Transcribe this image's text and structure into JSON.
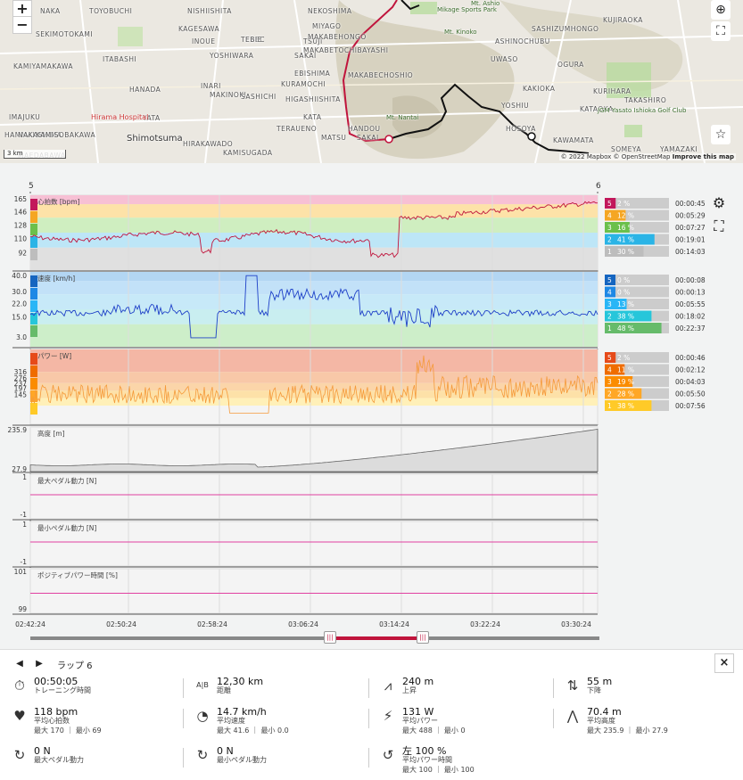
{
  "map": {
    "zoom_in": "+",
    "zoom_out": "−",
    "scale": "3 km",
    "attribution_1": "© 2022 Mapbox © OpenStreetMap",
    "attribution_2": "Improve this map",
    "labels": [
      {
        "t": "NAKA",
        "c": ""
      },
      {
        "t": "TOYOBUCHI",
        "c": ""
      },
      {
        "t": "NISHIISHITA",
        "c": ""
      },
      {
        "t": "NEKOSHIMA",
        "c": ""
      },
      {
        "t": "SEKIMOTOKAMI",
        "c": ""
      },
      {
        "t": "KAGESAWA",
        "c": ""
      },
      {
        "t": "MIYAGO",
        "c": ""
      },
      {
        "t": "TEBEC",
        "c": ""
      },
      {
        "t": "INOUE",
        "c": ""
      },
      {
        "t": "EBIE",
        "c": ""
      },
      {
        "t": "TSUJI",
        "c": ""
      },
      {
        "t": "MAKABEHONGO",
        "c": ""
      },
      {
        "t": "MAKABETOCHIBAYASHI",
        "c": ""
      },
      {
        "t": "KAMIYAMAKAWA",
        "c": ""
      },
      {
        "t": "ITABASHI",
        "c": ""
      },
      {
        "t": "YOSHIWARA",
        "c": ""
      },
      {
        "t": "SAKAI",
        "c": ""
      },
      {
        "t": "HANADA",
        "c": ""
      },
      {
        "t": "INARI",
        "c": ""
      },
      {
        "t": "KURAMOCHI",
        "c": ""
      },
      {
        "t": "EBISHIMA",
        "c": ""
      },
      {
        "t": "MAKABECHOSHIO",
        "c": ""
      },
      {
        "t": "MAKINOKI",
        "c": ""
      },
      {
        "t": "SASHICHI",
        "c": ""
      },
      {
        "t": "IMAJUKU",
        "c": ""
      },
      {
        "t": "YATA",
        "c": ""
      },
      {
        "t": "HIGASHIISHITA",
        "c": ""
      },
      {
        "t": "KATA",
        "c": ""
      },
      {
        "t": "TERAUENO",
        "c": ""
      },
      {
        "t": "HANDOU",
        "c": ""
      },
      {
        "t": "MATSU",
        "c": ""
      },
      {
        "t": "SAKAI",
        "c": ""
      },
      {
        "t": "Shimotsuma",
        "c": "big"
      },
      {
        "t": "HIRAKAWADO",
        "c": ""
      },
      {
        "t": "MAEDABAWA",
        "c": ""
      },
      {
        "t": "KAMISUGADA",
        "c": ""
      },
      {
        "t": "HAMMAKAMI",
        "c": ""
      },
      {
        "t": "NAKASHIMA",
        "c": ""
      },
      {
        "t": "KAMISOBAKAWA",
        "c": ""
      },
      {
        "t": "Hirama Hospital",
        "c": "hosp"
      },
      {
        "t": "Mikage Sports Park",
        "c": "green"
      },
      {
        "t": "Mt. Kinoko",
        "c": "green"
      },
      {
        "t": "Mt. Nantai",
        "c": "green"
      },
      {
        "t": "Mt. Ashio",
        "c": "green"
      },
      {
        "t": "HONGO",
        "c": ""
      },
      {
        "t": "KUJIRAOKA",
        "c": ""
      },
      {
        "t": "SASHIZUMI",
        "c": ""
      },
      {
        "t": "ASHINOCHUBU",
        "c": ""
      },
      {
        "t": "UWASO",
        "c": ""
      },
      {
        "t": "OGURA",
        "c": ""
      },
      {
        "t": "KAKIOKA",
        "c": ""
      },
      {
        "t": "YOSHIU",
        "c": ""
      },
      {
        "t": "KATAOKA",
        "c": ""
      },
      {
        "t": "HOSOYA",
        "c": ""
      },
      {
        "t": "KAWAMATA",
        "c": ""
      },
      {
        "t": "SOMEYA",
        "c": ""
      },
      {
        "t": "JGM Yasato Ishioka Golf Club",
        "c": "green"
      },
      {
        "t": "TAKASHIRO",
        "c": ""
      },
      {
        "t": "YAMAZAKI",
        "c": ""
      },
      {
        "t": "KURIHARA",
        "c": ""
      }
    ]
  },
  "charts": {
    "lap_start": "5",
    "lap_end": "6",
    "x_ticks": [
      "02:42:24",
      "02:50:24",
      "02:58:24",
      "03:06:24",
      "03:14:24",
      "03:22:24",
      "03:30:24"
    ],
    "panels": [
      {
        "title": "心拍数 [bpm]",
        "ticks": [
          "165",
          "146",
          "128",
          "110",
          "92"
        ]
      },
      {
        "title": "速度 [km/h]",
        "ticks": [
          "40.0",
          "30.0",
          "22.0",
          "15.0",
          "3.0"
        ]
      },
      {
        "title": "パワー [W]",
        "ticks": [
          "316",
          "276",
          "237",
          "197",
          "145"
        ]
      },
      {
        "title": "高度 [m]",
        "ticks": [
          "235.9",
          "27.9"
        ]
      },
      {
        "title": "最大ペダル動力 [N]",
        "ticks": [
          "1",
          "-1"
        ]
      },
      {
        "title": "最小ペダル動力 [N]",
        "ticks": [
          "1",
          "-1"
        ]
      },
      {
        "title": "ポジティブパワー時間 [%]",
        "ticks": [
          "101",
          "99"
        ]
      }
    ],
    "zones": [
      [
        {
          "z": "5",
          "pct": "2 %",
          "time": "00:00:45",
          "color": "#c2185b"
        },
        {
          "z": "4",
          "pct": "12 %",
          "time": "00:05:29",
          "color": "#f5a623"
        },
        {
          "z": "3",
          "pct": "16 %",
          "time": "00:07:27",
          "color": "#6bc04b"
        },
        {
          "z": "2",
          "pct": "41 %",
          "time": "00:19:01",
          "color": "#2ab4e6"
        },
        {
          "z": "1",
          "pct": "30 %",
          "time": "00:14:03",
          "color": "#bdbdbd"
        }
      ],
      [
        {
          "z": "5",
          "pct": "0 %",
          "time": "00:00:08",
          "color": "#1565c0"
        },
        {
          "z": "4",
          "pct": "0 %",
          "time": "00:00:13",
          "color": "#1e88e5"
        },
        {
          "z": "3",
          "pct": "13 %",
          "time": "00:05:55",
          "color": "#29b6f6"
        },
        {
          "z": "2",
          "pct": "38 %",
          "time": "00:18:02",
          "color": "#26c6da"
        },
        {
          "z": "1",
          "pct": "48 %",
          "time": "00:22:37",
          "color": "#66bb6a"
        }
      ],
      [
        {
          "z": "5",
          "pct": "2 %",
          "time": "00:00:46",
          "color": "#e64a19"
        },
        {
          "z": "4",
          "pct": "11 %",
          "time": "00:02:12",
          "color": "#ef6c00"
        },
        {
          "z": "3",
          "pct": "19 %",
          "time": "00:04:03",
          "color": "#fb8c00"
        },
        {
          "z": "2",
          "pct": "28 %",
          "time": "00:05:50",
          "color": "#ffa726"
        },
        {
          "z": "1",
          "pct": "38 %",
          "time": "00:07:56",
          "color": "#ffca28"
        }
      ]
    ]
  },
  "summary": {
    "lap_label": "ラップ 6",
    "close": "×",
    "stats": [
      {
        "icon": "stopwatch-icon",
        "glyph": "⏱",
        "val": "00:50:05",
        "lbl": "トレーニング時間",
        "sub": ""
      },
      {
        "icon": "distance-icon",
        "glyph": "A|B",
        "val": "12,30 km",
        "lbl": "距離",
        "sub": ""
      },
      {
        "icon": "ascent-icon",
        "glyph": "⩘",
        "val": "240 m",
        "lbl": "上昇",
        "sub": ""
      },
      {
        "icon": "descent-icon",
        "glyph": "⇅",
        "val": "55 m",
        "lbl": "下降",
        "sub": ""
      },
      {
        "icon": "heart-icon",
        "glyph": "♥",
        "val": "118 bpm",
        "lbl": "平均心拍数",
        "sub": "最大 170 ｜ 最小 69"
      },
      {
        "icon": "speedometer-icon",
        "glyph": "◔",
        "val": "14.7 km/h",
        "lbl": "平均速度",
        "sub": "最大 41.6 ｜ 最小 0.0"
      },
      {
        "icon": "power-icon",
        "glyph": "⚡",
        "val": "131 W",
        "lbl": "平均パワー",
        "sub": "最大 488 ｜ 最小 0"
      },
      {
        "icon": "altitude-icon",
        "glyph": "⋀",
        "val": "70.4 m",
        "lbl": "平均高度",
        "sub": "最大 235.9 ｜ 最小 27.9"
      },
      {
        "icon": "max-pedal-force-icon",
        "glyph": "↻",
        "val": "0 N",
        "lbl": "最大ペダル動力",
        "sub": ""
      },
      {
        "icon": "min-pedal-force-icon",
        "glyph": "↻",
        "val": "0 N",
        "lbl": "最小ペダル動力",
        "sub": ""
      },
      {
        "icon": "positive-power-icon",
        "glyph": "↺",
        "val": "左 100 %",
        "lbl": "平均パワー時間",
        "sub2a": "最大 100",
        "sub2b": "最小 100",
        "sub": "最大 100 ｜ 最小 100"
      }
    ]
  }
}
